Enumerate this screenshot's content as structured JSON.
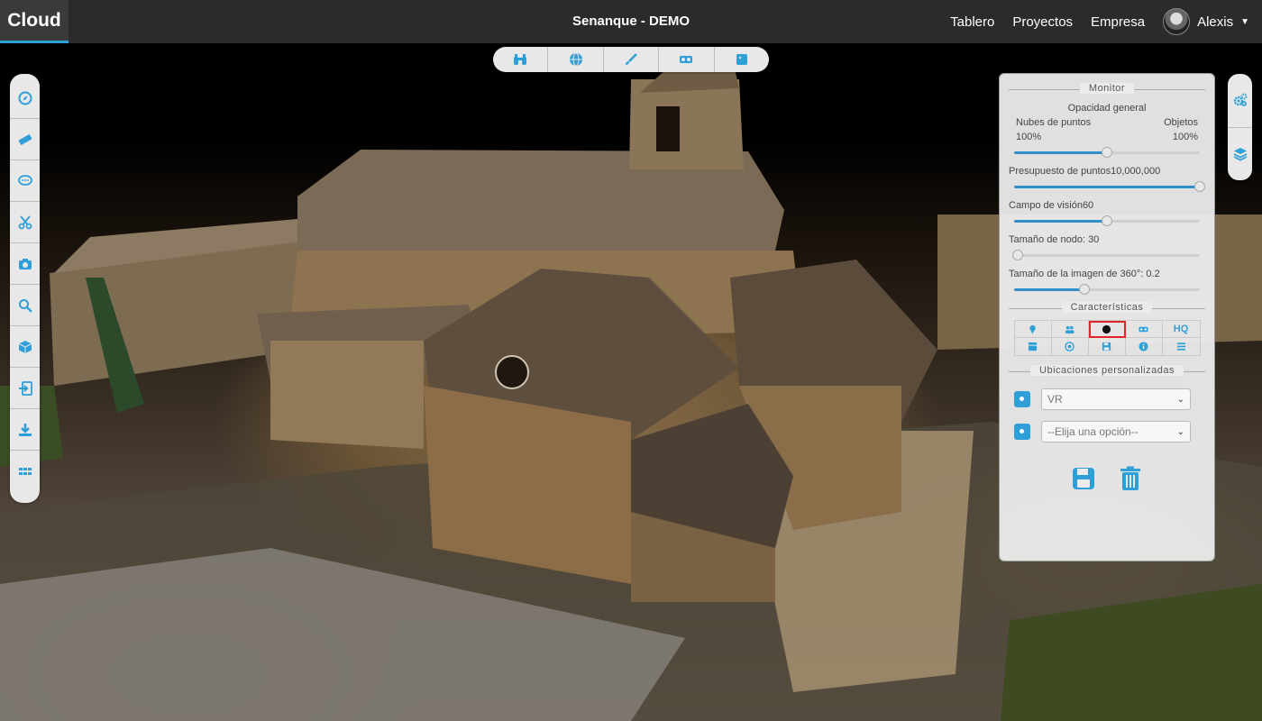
{
  "header": {
    "brand": "Cloud",
    "project_title": "Senanque - DEMO",
    "nav": [
      "Tablero",
      "Proyectos",
      "Empresa"
    ],
    "user_name": "Alexis"
  },
  "colors": {
    "accent": "#2f9fd8",
    "topbar": "#2b2b2b",
    "highlight": "#e0242b"
  },
  "left_tools": [
    "compass-icon",
    "ruler-icon",
    "comment-icon",
    "scissors-icon",
    "camera-icon",
    "search-icon",
    "cube-icon",
    "import-icon",
    "download-icon",
    "grid-icon"
  ],
  "view_tools": [
    "binoculars-icon",
    "globe-icon",
    "brush-icon",
    "vr-headset-icon",
    "square-icon"
  ],
  "right_tools": [
    "settings-cogs-icon",
    "layers-icon"
  ],
  "panel": {
    "monitor_title": "Monitor",
    "opacity_label": "Opacidad general",
    "point_clouds_label": "Nubes de puntos",
    "objects_label": "Objetos",
    "point_clouds_value": "100%",
    "objects_value": "100%",
    "opacity_balance": 0.5,
    "point_budget_label": "Presupuesto de puntos",
    "point_budget_value": "10,000,000",
    "point_budget_level": 1.0,
    "fov_label": "Campo de visión",
    "fov_value": "60",
    "fov_level": 0.5,
    "node_size_label": "Tamaño de nodo: 30",
    "node_size_level": 0.02,
    "pano_size_label": "Tamaño de la imagen de 360°: 0.2",
    "pano_size_level": 0.38,
    "features_title": "Características",
    "features_row1": [
      "marker-icon",
      "users-icon",
      "dot-icon",
      "vr-icon",
      "HQ"
    ],
    "features_row2": [
      "box-icon",
      "target-icon",
      "save-icon",
      "info-icon",
      "list-icon"
    ],
    "custom_locations_title": "Ubicaciones personalizadas",
    "location_select_1": "VR",
    "location_select_2": "--Elija una opción--"
  }
}
